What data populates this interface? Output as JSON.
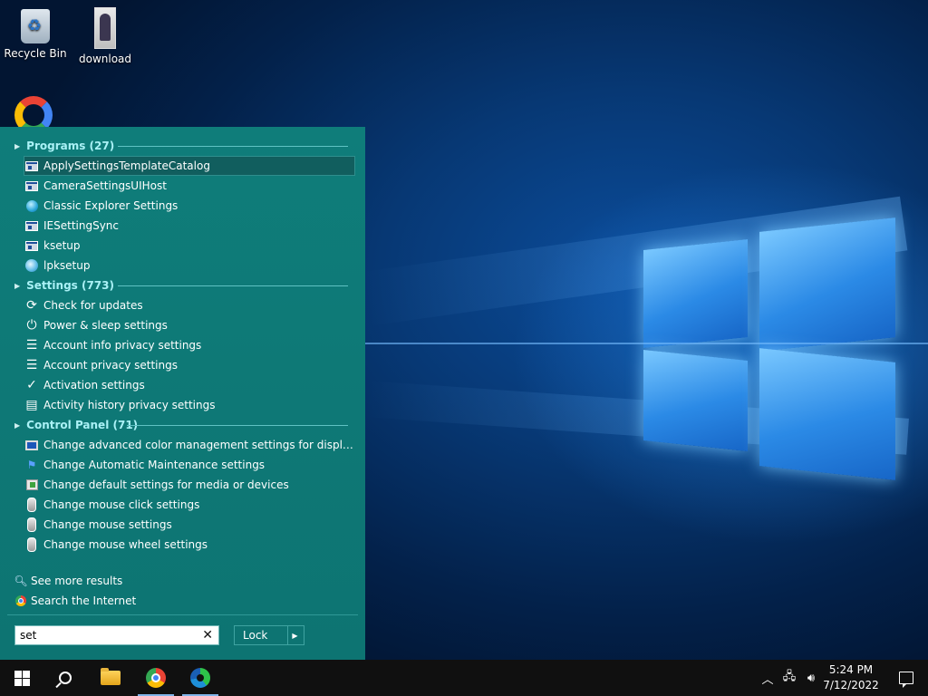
{
  "desktop": {
    "icons": [
      {
        "label": "Recycle Bin",
        "icon": "recycle-bin-icon"
      },
      {
        "label": "download",
        "icon": "image-file-icon"
      }
    ],
    "partial_icon": "google-chrome-icon"
  },
  "start_menu": {
    "accent_color": "#0e7a78",
    "header_color": "#aaf1f6",
    "groups": {
      "programs": {
        "header": "Programs (27)",
        "items": [
          {
            "label": "ApplySettingsTemplateCatalog",
            "icon": "app-window-icon",
            "selected": true
          },
          {
            "label": "CameraSettingsUIHost",
            "icon": "app-window-icon"
          },
          {
            "label": "Classic Explorer Settings",
            "icon": "globe-icon"
          },
          {
            "label": "IESettingSync",
            "icon": "app-window-icon"
          },
          {
            "label": "ksetup",
            "icon": "app-window-icon"
          },
          {
            "label": "lpksetup",
            "icon": "language-globe-icon"
          }
        ]
      },
      "settings": {
        "header": "Settings (773)",
        "items": [
          {
            "label": "Check for updates",
            "icon": "refresh-icon"
          },
          {
            "label": "Power & sleep settings",
            "icon": "power-icon"
          },
          {
            "label": "Account info privacy settings",
            "icon": "account-list-icon"
          },
          {
            "label": "Account privacy settings",
            "icon": "account-list-icon"
          },
          {
            "label": "Activation settings",
            "icon": "check-circle-icon"
          },
          {
            "label": "Activity history privacy settings",
            "icon": "timeline-icon"
          }
        ]
      },
      "control_panel": {
        "header": "Control Panel (71)",
        "items": [
          {
            "label": "Change advanced color management settings for displays, sca...",
            "icon": "monitor-icon"
          },
          {
            "label": "Change Automatic Maintenance settings",
            "icon": "flag-icon"
          },
          {
            "label": "Change default settings for media or devices",
            "icon": "autoplay-icon"
          },
          {
            "label": "Change mouse click settings",
            "icon": "mouse-icon"
          },
          {
            "label": "Change mouse settings",
            "icon": "mouse-icon"
          },
          {
            "label": "Change mouse wheel settings",
            "icon": "mouse-icon"
          }
        ]
      }
    },
    "see_more": "See more results",
    "search_internet": "Search the Internet",
    "search": {
      "value": "set",
      "placeholder": ""
    },
    "power_button": "Lock"
  },
  "taskbar": {
    "pinned": [
      {
        "name": "start",
        "icon": "windows-logo-icon"
      },
      {
        "name": "search",
        "icon": "search-icon"
      },
      {
        "name": "file-explorer",
        "icon": "folder-icon"
      },
      {
        "name": "chrome",
        "icon": "chrome-icon"
      },
      {
        "name": "edge",
        "icon": "edge-icon"
      }
    ],
    "tray_icons": [
      "chevron-up-icon",
      "network-icon",
      "volume-icon"
    ],
    "time": "5:24 PM",
    "date": "7/12/2022",
    "notification_icon": "notification-icon"
  }
}
